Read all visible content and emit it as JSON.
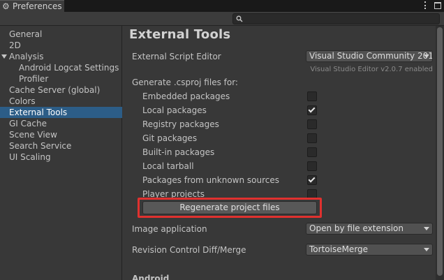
{
  "window": {
    "title": "Preferences"
  },
  "search": {
    "placeholder": ""
  },
  "sidebar": {
    "items": [
      {
        "label": "General"
      },
      {
        "label": "2D"
      },
      {
        "label": "Analysis"
      },
      {
        "label": "Android Logcat Settings"
      },
      {
        "label": "Profiler"
      },
      {
        "label": "Cache Server (global)"
      },
      {
        "label": "Colors"
      },
      {
        "label": "External Tools"
      },
      {
        "label": "GI Cache"
      },
      {
        "label": "Scene View"
      },
      {
        "label": "Search Service"
      },
      {
        "label": "UI Scaling"
      }
    ],
    "selected": "External Tools"
  },
  "main": {
    "title": "External Tools",
    "script_editor": {
      "label": "External Script Editor",
      "value": "Visual Studio Community 201",
      "note": "Visual Studio Editor v2.0.7 enabled"
    },
    "generate_heading": "Generate .csproj files for:",
    "packages": [
      {
        "label": "Embedded packages",
        "checked": false
      },
      {
        "label": "Local packages",
        "checked": true
      },
      {
        "label": "Registry packages",
        "checked": false
      },
      {
        "label": "Git packages",
        "checked": false
      },
      {
        "label": "Built-in packages",
        "checked": false
      },
      {
        "label": "Local tarball",
        "checked": false
      },
      {
        "label": "Packages from unknown sources",
        "checked": true
      },
      {
        "label": "Player projects",
        "checked": false
      }
    ],
    "regenerate_button": "Regenerate project files",
    "image_application": {
      "label": "Image application",
      "value": "Open by file extension"
    },
    "revision_control": {
      "label": "Revision Control Diff/Merge",
      "value": "TortoiseMerge"
    },
    "section_android": "Android"
  },
  "colors": {
    "selection": "#2c5d87",
    "highlight": "#e0312f",
    "background": "#383838"
  }
}
